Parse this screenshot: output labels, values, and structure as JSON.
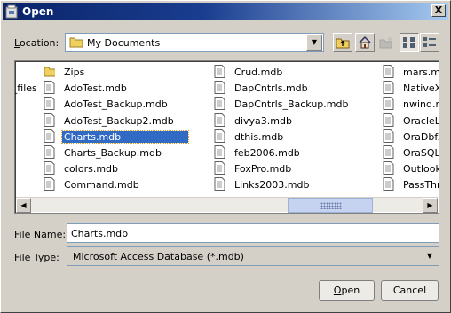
{
  "dialog": {
    "title": "Open",
    "close_label": "X"
  },
  "location": {
    "label_mnemonic": "L",
    "label_rest": "ocation:",
    "value": "My Documents"
  },
  "toolbar": {
    "icons": [
      "up-one-level-icon",
      "home-icon",
      "new-folder-icon",
      "list-view-icon",
      "details-view-icon"
    ]
  },
  "files": {
    "columns": [
      {
        "items": [
          {
            "name": "Zips",
            "type": "folder"
          },
          {
            "name": "e_files",
            "type": "folder-partial"
          },
          {
            "name": "",
            "type": "empty"
          },
          {
            "name": "",
            "type": "empty"
          },
          {
            "name": "",
            "type": "empty"
          },
          {
            "name": "",
            "type": "empty"
          },
          {
            "name": "",
            "type": "empty"
          }
        ]
      },
      {
        "items": [
          {
            "name": "AdoTest.mdb",
            "type": "file"
          },
          {
            "name": "AdoTest_Backup.mdb",
            "type": "file"
          },
          {
            "name": "AdoTest_Backup2.mdb",
            "type": "file"
          },
          {
            "name": "Charts.mdb",
            "type": "file"
          },
          {
            "name": "Charts_Backup.mdb",
            "type": "file"
          },
          {
            "name": "colors.mdb",
            "type": "file"
          },
          {
            "name": "Command.mdb",
            "type": "file"
          }
        ]
      },
      {
        "items": [
          {
            "name": "Crud.mdb",
            "type": "file"
          },
          {
            "name": "DapCntrls.mdb",
            "type": "file"
          },
          {
            "name": "DapCntrls_Backup.mdb",
            "type": "file"
          },
          {
            "name": "divya3.mdb",
            "type": "file"
          },
          {
            "name": "dthis.mdb",
            "type": "file"
          },
          {
            "name": "feb2006.mdb",
            "type": "file"
          },
          {
            "name": "FoxPro.mdb",
            "type": "file"
          },
          {
            "name": "Links2003.mdb",
            "type": "file"
          }
        ]
      },
      {
        "items": [
          {
            "name": "mars.mdb",
            "type": "file"
          },
          {
            "name": "NativeXM",
            "type": "file"
          },
          {
            "name": "nwind.m",
            "type": "file"
          },
          {
            "name": "OracleLin",
            "type": "file"
          },
          {
            "name": "OraDbf.m",
            "type": "file"
          },
          {
            "name": "OraSQLT",
            "type": "file"
          },
          {
            "name": "Outlook()",
            "type": "file"
          },
          {
            "name": "PassThru",
            "type": "file"
          }
        ]
      }
    ],
    "selected": "Charts.mdb"
  },
  "file_name": {
    "label_pre": "File ",
    "label_mnemonic": "N",
    "label_post": "ame:",
    "value": "Charts.mdb"
  },
  "file_type": {
    "label_pre": "File ",
    "label_mnemonic": "T",
    "label_post": "ype:",
    "value": "Microsoft Access Database (*.mdb)"
  },
  "buttons": {
    "open_mnemonic": "O",
    "open_rest": "pen",
    "cancel": "Cancel"
  },
  "colors": {
    "selection": "#316ac5",
    "title_bar": "#0a246a",
    "dialog_bg": "#d4d0c8"
  }
}
